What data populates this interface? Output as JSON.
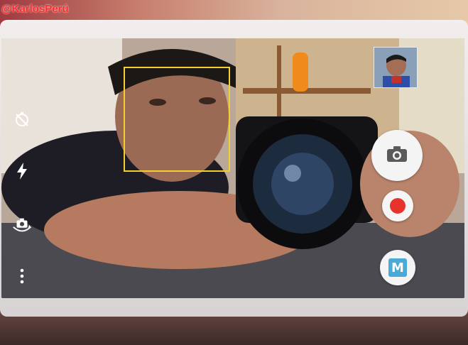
{
  "watermark": "@KarlosPerú",
  "icons": {
    "timer": "timer-off-icon",
    "flash": "flash-icon",
    "switch_camera": "switch-camera-icon",
    "more": "more-options-icon",
    "shutter": "camera-icon",
    "record": "record-icon"
  },
  "mode_button": {
    "label": "M"
  },
  "colors": {
    "focus_box": "#f3d02f",
    "record": "#e8322c",
    "mode_accent": "#49a9d9"
  }
}
